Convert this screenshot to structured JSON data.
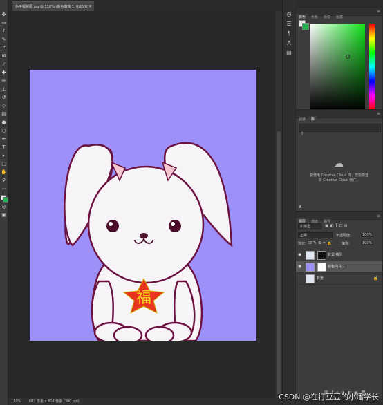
{
  "document": {
    "tab_title": "兔子福特图.jpg @ 110% (颜色填充 1, RGB/8) *",
    "close": "×"
  },
  "status": {
    "zoom": "110%",
    "size": "683 像素 x 814 像素 (300 ppi)"
  },
  "artwork": {
    "badge_text": "福",
    "background_color": "#9d90f8",
    "outline_color": "#6b1240"
  },
  "color_panel": {
    "tabs": [
      "颜色",
      "色板",
      "渐变",
      "图案"
    ],
    "foreground": "#e8e8e8",
    "background": "#21b04b"
  },
  "libraries_panel": {
    "tabs": [
      "调整",
      "库"
    ],
    "message_line1": "要使用 Creative Cloud 库，您需要登",
    "message_line2": "录 Creative Cloud 帐户。"
  },
  "layers_panel": {
    "tabs": [
      "图层",
      "通道",
      "路径"
    ],
    "filter": "类型",
    "blend_mode": "正常",
    "opacity_label": "不透明度:",
    "opacity": "100%",
    "lock_label": "锁定:",
    "fill_label": "填充:",
    "fill": "100%",
    "layers": [
      {
        "name": "背景 拷贝",
        "selected": false,
        "visible": true
      },
      {
        "name": "颜色填充 1",
        "selected": true,
        "visible": true
      },
      {
        "name": "背景",
        "selected": false,
        "visible": false
      }
    ]
  },
  "watermark": "CSDN @在打豆豆的小潘学长",
  "icons": {
    "toolbar": [
      "move-icon",
      "marquee-icon",
      "lasso-icon",
      "quick-select-icon",
      "crop-icon",
      "frame-icon",
      "eyedropper-icon",
      "healing-icon",
      "brush-icon",
      "stamp-icon",
      "history-brush-icon",
      "eraser-icon",
      "gradient-icon",
      "blur-icon",
      "dodge-icon",
      "pen-icon",
      "type-icon",
      "path-select-icon",
      "rectangle-icon",
      "hand-icon",
      "zoom-icon",
      "more-icon"
    ],
    "strip": [
      "history-icon",
      "properties-icon",
      "paragraph-icon",
      "character-icon",
      "library-icon"
    ]
  }
}
